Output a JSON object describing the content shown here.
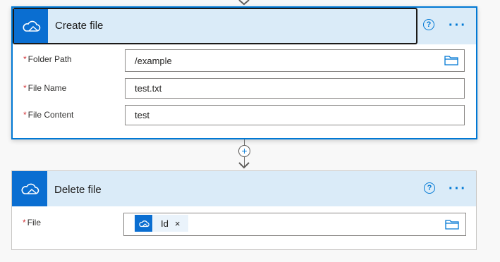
{
  "create_file": {
    "title": "Create file",
    "connector_icon": "onedrive-cloud-icon",
    "help_label": "?",
    "more_label": "···",
    "fields": {
      "folder_path": {
        "required_mark": "*",
        "label": "Folder Path",
        "value": "/example"
      },
      "file_name": {
        "required_mark": "*",
        "label": "File Name",
        "value": "test.txt"
      },
      "file_content": {
        "required_mark": "*",
        "label": "File Content",
        "value": "test"
      }
    }
  },
  "add_step": {
    "label": "+"
  },
  "delete_file": {
    "title": "Delete file",
    "connector_icon": "onedrive-cloud-icon",
    "help_label": "?",
    "more_label": "···",
    "fields": {
      "file": {
        "required_mark": "*",
        "label": "File",
        "token": {
          "label": "Id",
          "remove_label": "×"
        }
      }
    }
  },
  "colors": {
    "accent": "#0078d4",
    "header_bg": "#daebf8",
    "connector_tile": "#0a6ed1",
    "required": "#d13438"
  }
}
